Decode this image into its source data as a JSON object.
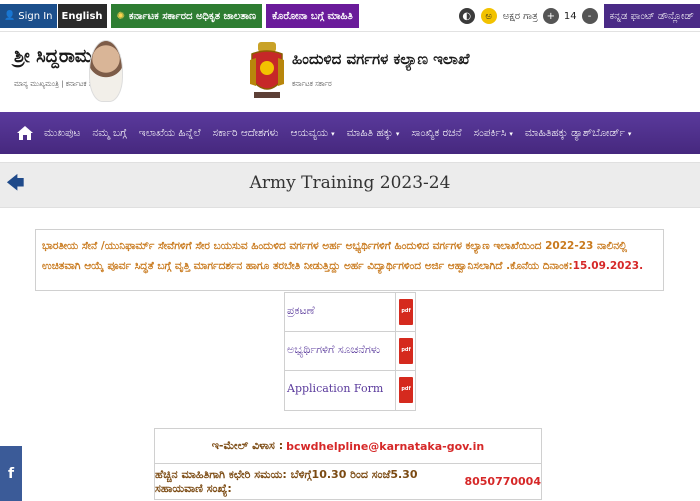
{
  "topbar": {
    "signin": "Sign In",
    "english": "English",
    "gov_link": "ಕರ್ನಾಟಕ ಸರ್ಕಾರದ ಅಧಿಕೃತ ಜಾಲತಾಣ",
    "corona_link": "ಕೊರೋನಾ ಬಗ್ಗೆ ಮಾಹಿತಿ",
    "font_size_label": "ಅಕ್ಷರ ಗಾತ್ರ",
    "plus": "+",
    "font_size_value": "14",
    "minus": "-",
    "lang_button": "ಕನ್ನಡ ಫಾಂಟ್ ಡೌನ್ಲೋಡ್",
    "contrast_icon": "contrast-icon",
    "font_icon": "font-a-icon"
  },
  "header": {
    "cm_name": "ಶ್ರೀ ಸಿದ್ದರಾಮಯ್ಯ",
    "cm_tagline": "ಮಾನ್ಯ ಮುಖ್ಯಮಂತ್ರಿ | ಕರ್ನಾಟಕ ಸರ್ಕಾರ",
    "dept_name": "ಹಿಂದುಳಿದ ವರ್ಗಗಳ ಕಲ್ಯಾಣ ಇಲಾಖೆ",
    "dept_sub": "ಕರ್ನಾಟಕ ಸರ್ಕಾರ"
  },
  "nav": {
    "items": [
      {
        "label": "ಮುಖಪುಟ",
        "dropdown": false
      },
      {
        "label": "ನಮ್ಮ ಬಗ್ಗೆ",
        "dropdown": false
      },
      {
        "label": "ಇಲಾಖೆಯ ಹಿನ್ನೆಲೆ",
        "dropdown": false
      },
      {
        "label": "ಸರ್ಕಾರಿ ಆದೇಶಗಳು",
        "dropdown": false
      },
      {
        "label": "ಆಯವ್ಯಯ",
        "dropdown": true
      },
      {
        "label": "ಮಾಹಿತಿ ಹಕ್ಕು",
        "dropdown": true
      },
      {
        "label": "ಸಾಂಖ್ಯಿಕ ರಚನೆ",
        "dropdown": false
      },
      {
        "label": "ಸಂಪರ್ಕಿಸಿ",
        "dropdown": true
      },
      {
        "label": "ಮಾಹಿತಿಹಕ್ಕು ಡ್ಯಾಶ್‌ಬೋರ್ಡ್",
        "dropdown": true
      }
    ],
    "caret": "▾"
  },
  "page": {
    "back_glyph": "🡄",
    "title": "Army Training 2023-24"
  },
  "notice": {
    "text": "ಭಾರತೀಯ ಸೇನೆ /ಯುನಿಫಾರ್ಮ್ ಸೇವೆಗಳಿಗೆ ಸೇರ ಬಯಸುವ ಹಿಂದುಳಿದ ವರ್ಗಗಳ ಅರ್ಹ ಅಭ್ಯರ್ಥಿಗಳಿಗೆ ಹಿಂದುಳಿದ ವರ್ಗಗಳ ಕಲ್ಯಾಣ ಇಲಾಖೆಯಿಂದ 2022-23 ನಾಲಿನಲ್ಲಿ ಉಚಿತವಾಗಿ ಆಯ್ಕೆ ಪೂರ್ವ ಸಿದ್ಧತೆ ಬಗ್ಗೆ ವೃತ್ತಿ ಮಾರ್ಗದರ್ಶನ ಹಾಗೂ ತರಬೇತಿ ನೀಡುತ್ತಿದ್ದು ಅರ್ಹ ವಿದ್ಯಾರ್ಥಿಗಳಿಂದ ಅರ್ಜಿ ಆಹ್ವಾನಿಸಲಾಗಿದೆ .ಕೊನೆಯ ದಿನಾಂಕ:",
    "date": "15.09.2023."
  },
  "documents": [
    {
      "label": "ಪ್ರಕಟಣೆ",
      "icon": "pdf-icon",
      "icon_text": "pdf"
    },
    {
      "label": "ಅಭ್ಯರ್ಥಿಗಳಿಗೆ ಸೂಚನೆಗಳು",
      "icon": "pdf-icon",
      "icon_text": "pdf"
    },
    {
      "label": "Application Form",
      "icon": "pdf-icon",
      "icon_text": "pdf"
    }
  ],
  "contact": {
    "email_label": "ಇ-ಮೇಲ್ ವಿಳಾಸ :",
    "email": "bcwdhelpline@karnataka-gov.in",
    "hours_label": "ಹೆಚ್ಚಿನ ಮಾಹಿತಿಗಾಗಿ ಕಛೇರಿ ಸಮಯ: ಬೆಳಿಗ್ಗೆ10.30 ರಿಂದ ಸಂಜೆ5.30 ಸಹಾಯವಾಣಿ ಸಂಖ್ಯೆ:",
    "phone": "8050770004"
  },
  "social": {
    "facebook": "f"
  },
  "colors": {
    "nav_purple": "#4b2c86",
    "notice_orange": "#c97a1e",
    "accent_red": "#d62828",
    "fb_blue": "#3b5b98"
  }
}
